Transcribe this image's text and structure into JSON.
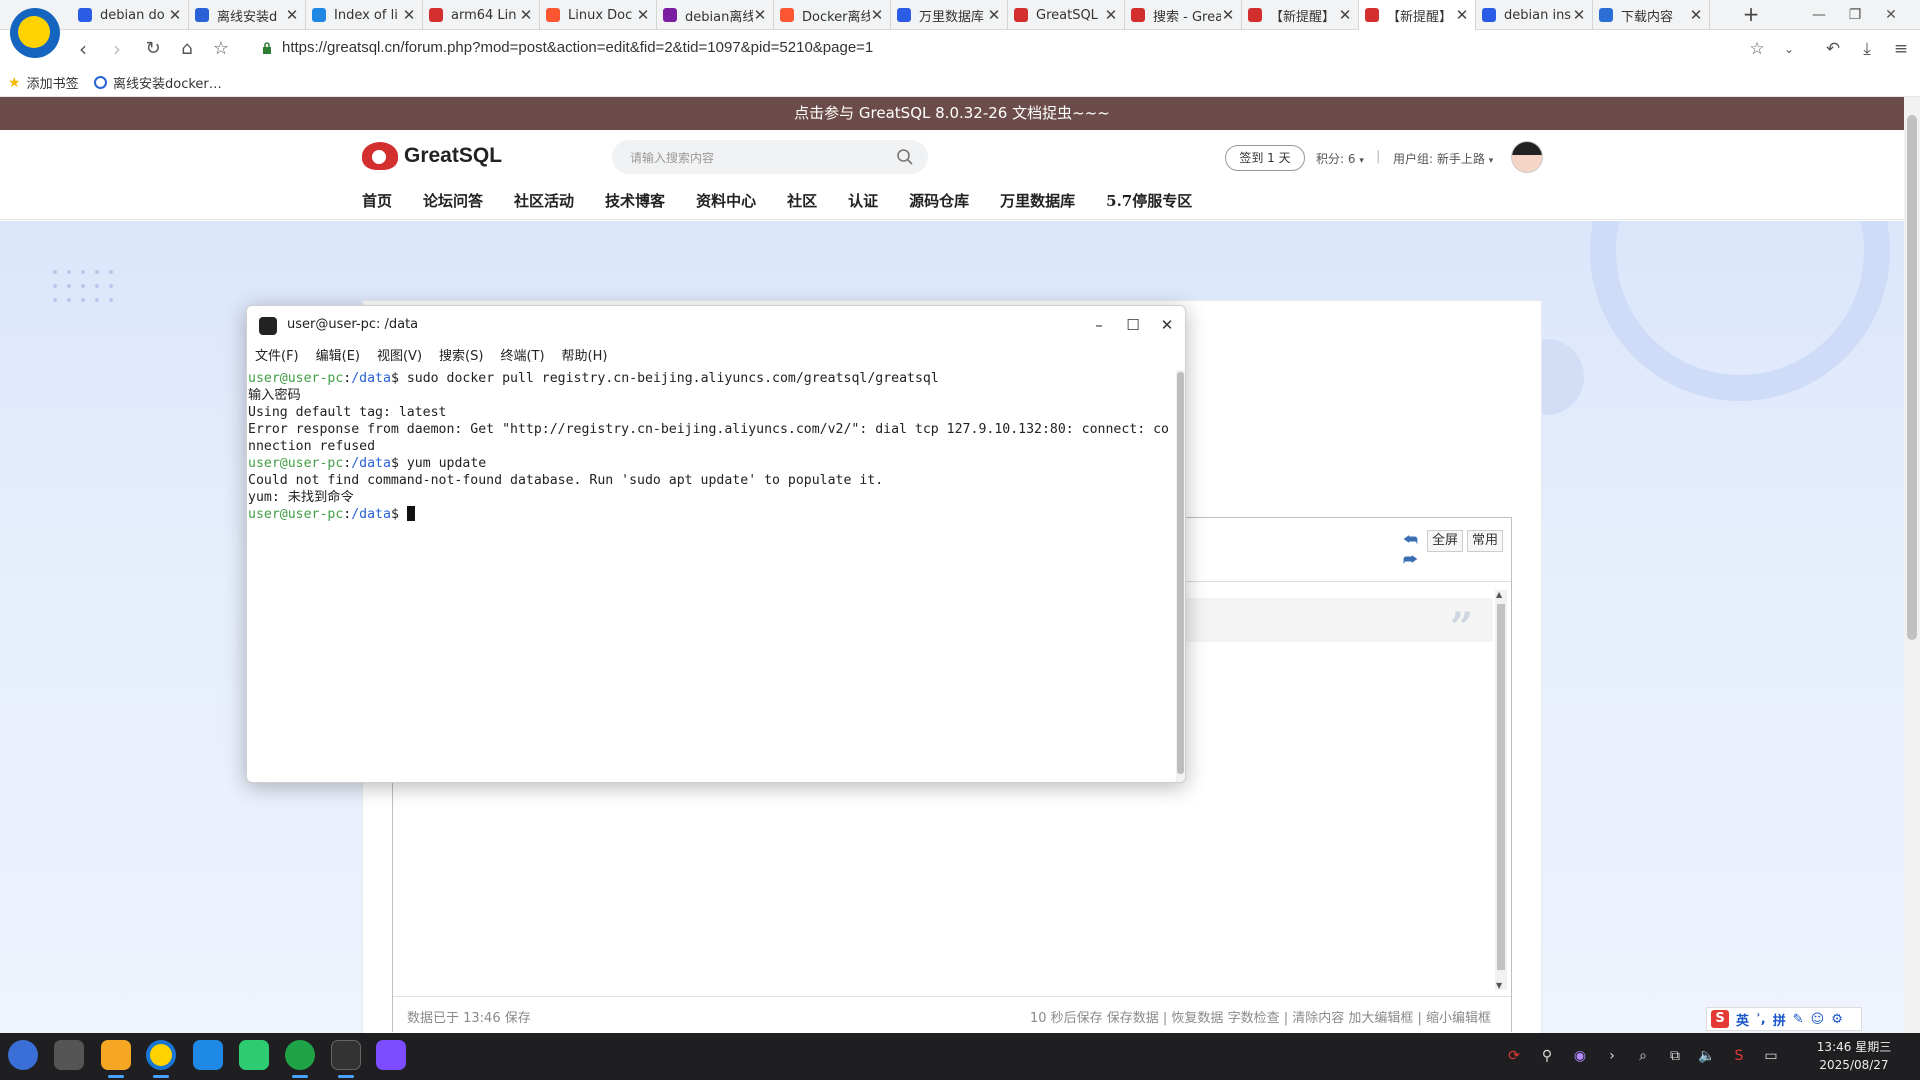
{
  "browser": {
    "tabs": [
      {
        "title": "debian do",
        "favicon": "baidu-paw-icon",
        "color": "#2b5ce6"
      },
      {
        "title": "离线安装d",
        "favicon": "globe-icon",
        "color": "#2962d6"
      },
      {
        "title": "Index of li",
        "favicon": "globe-icon",
        "color": "#1e88e5"
      },
      {
        "title": "arm64 Lin",
        "favicon": "51cto-icon",
        "color": "#d32f2f"
      },
      {
        "title": "Linux Doc",
        "favicon": "csdn-icon",
        "color": "#fc5531"
      },
      {
        "title": "debian离线",
        "favicon": "c-icon",
        "color": "#7b1fa2"
      },
      {
        "title": "Docker离线",
        "favicon": "csdn-icon",
        "color": "#fc5531"
      },
      {
        "title": "万里数据库",
        "favicon": "baidu-paw-icon",
        "color": "#2b5ce6"
      },
      {
        "title": "GreatSQL",
        "favicon": "greatsql-icon",
        "color": "#d32f2f"
      },
      {
        "title": "搜索 - Grea",
        "favicon": "greatsql-icon",
        "color": "#d32f2f"
      },
      {
        "title": "【新提醒】",
        "favicon": "greatsql-icon",
        "color": "#d32f2f"
      },
      {
        "title": "【新提醒】",
        "favicon": "greatsql-icon",
        "color": "#d32f2f"
      },
      {
        "title": "debian ins",
        "favicon": "baidu-paw-icon",
        "color": "#2b5ce6"
      },
      {
        "title": "下载内容",
        "favicon": "download-icon",
        "color": "#2b6fd6"
      }
    ],
    "active_tab_index": 11,
    "url": "https://greatsql.cn/forum.php?mod=post&action=edit&fid=2&tid=1097&pid=5210&page=1",
    "bookmarks": [
      {
        "label": "添加书签",
        "icon": "star-icon"
      },
      {
        "label": "离线安装docker…",
        "icon": "globe-icon"
      }
    ]
  },
  "site": {
    "announcement": "点击参与 GreatSQL 8.0.32-26 文档捉虫~~~",
    "logo_text": "GreatSQL",
    "search_placeholder": "请输入搜索内容",
    "signin_label": "签到 1 天",
    "points": "积分: 6",
    "user_group": "用户组: 新手上路",
    "nav": [
      "首页",
      "论坛问答",
      "社区活动",
      "技术博客",
      "资料中心",
      "社区",
      "认证",
      "源码仓库",
      "万里数据库",
      "5.7停服专区"
    ]
  },
  "editor": {
    "fullscreen_label": "全屏",
    "common_label": "常用",
    "saved_text": "数据已于 13:46 保存",
    "footer_links": "10 秒后保存 保存数据 | 恢复数据    字数检查 | 清除内容    加大编辑框 | 缩小编辑框"
  },
  "terminal": {
    "title": "user@user-pc: /data",
    "menu": [
      "文件(F)",
      "编辑(E)",
      "视图(V)",
      "搜索(S)",
      "终端(T)",
      "帮助(H)"
    ],
    "prompt_user": "user@user-pc",
    "prompt_path": "/data",
    "lines": [
      {
        "type": "prompt",
        "cmd": "sudo docker pull registry.cn-beijing.aliyuncs.com/greatsql/greatsql"
      },
      {
        "type": "out",
        "text": "输入密码"
      },
      {
        "type": "out",
        "text": "Using default tag: latest"
      },
      {
        "type": "out",
        "text": "Error response from daemon: Get \"http://registry.cn-beijing.aliyuncs.com/v2/\": dial tcp 127.9.10.132:80: connect: co"
      },
      {
        "type": "out",
        "text": "nnection refused"
      },
      {
        "type": "prompt",
        "cmd": "yum update"
      },
      {
        "type": "out",
        "text": "Could not find command-not-found database. Run 'sudo apt update' to populate it."
      },
      {
        "type": "out",
        "text": "yum: 未找到命令"
      },
      {
        "type": "prompt",
        "cmd": ""
      }
    ]
  },
  "ime": {
    "lang": "英",
    "mode": "拼"
  },
  "taskbar": {
    "time": "13:46 星期三",
    "date": "2025/08/27"
  }
}
